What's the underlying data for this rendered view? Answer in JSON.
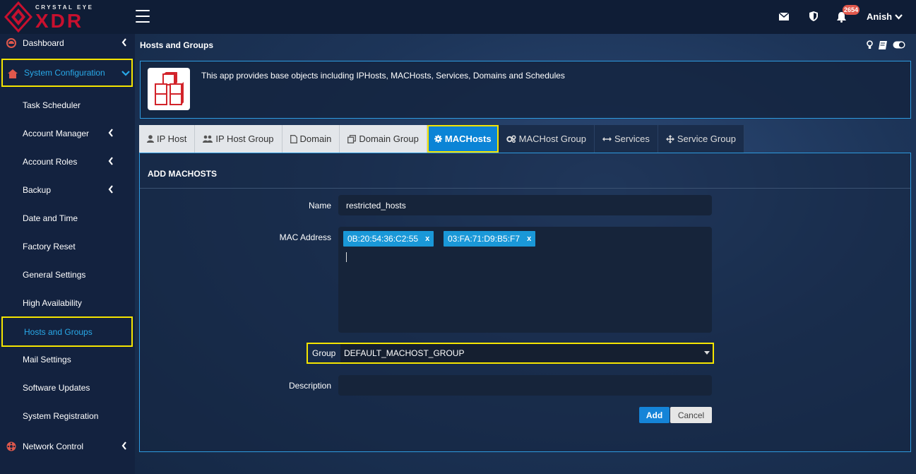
{
  "brand": {
    "line1": "CRYSTAL EYE",
    "line2": "XDR",
    "accent": "#c8102e"
  },
  "header": {
    "notification_count": "2654",
    "user_name": "Anish"
  },
  "sidebar": {
    "items": [
      {
        "label": "Dashboard",
        "icon": "dashboard-icon"
      },
      {
        "label": "System Configuration",
        "icon": "home-icon"
      },
      {
        "label": "Task Scheduler"
      },
      {
        "label": "Account Manager"
      },
      {
        "label": "Account Roles"
      },
      {
        "label": "Backup"
      },
      {
        "label": "Date and Time"
      },
      {
        "label": "Factory Reset"
      },
      {
        "label": "General Settings"
      },
      {
        "label": "High Availability"
      },
      {
        "label": "Hosts and Groups"
      },
      {
        "label": "Mail Settings"
      },
      {
        "label": "Software Updates"
      },
      {
        "label": "System Registration"
      },
      {
        "label": "Network Control",
        "icon": "network-icon"
      }
    ]
  },
  "page": {
    "title": "Hosts and Groups",
    "info_text": "This app provides base objects including IPHosts, MACHosts, Services, Domains and Schedules"
  },
  "tabs": [
    {
      "label": "IP Host"
    },
    {
      "label": "IP Host Group"
    },
    {
      "label": "Domain"
    },
    {
      "label": "Domain Group"
    },
    {
      "label": "MACHosts"
    },
    {
      "label": "MACHost Group"
    },
    {
      "label": "Services"
    },
    {
      "label": "Service Group"
    }
  ],
  "form": {
    "heading": "ADD MACHOSTS",
    "name_label": "Name",
    "name_value": "restricted_hosts",
    "mac_label": "MAC Address",
    "mac_addresses": [
      "0B:20:54:36:C2:55",
      "03:FA:71:D9:B5:F7"
    ],
    "chip_remove": "x",
    "group_label": "Group",
    "group_value": "DEFAULT_MACHOST_GROUP",
    "description_label": "Description",
    "description_value": "",
    "add_label": "Add",
    "cancel_label": "Cancel"
  }
}
